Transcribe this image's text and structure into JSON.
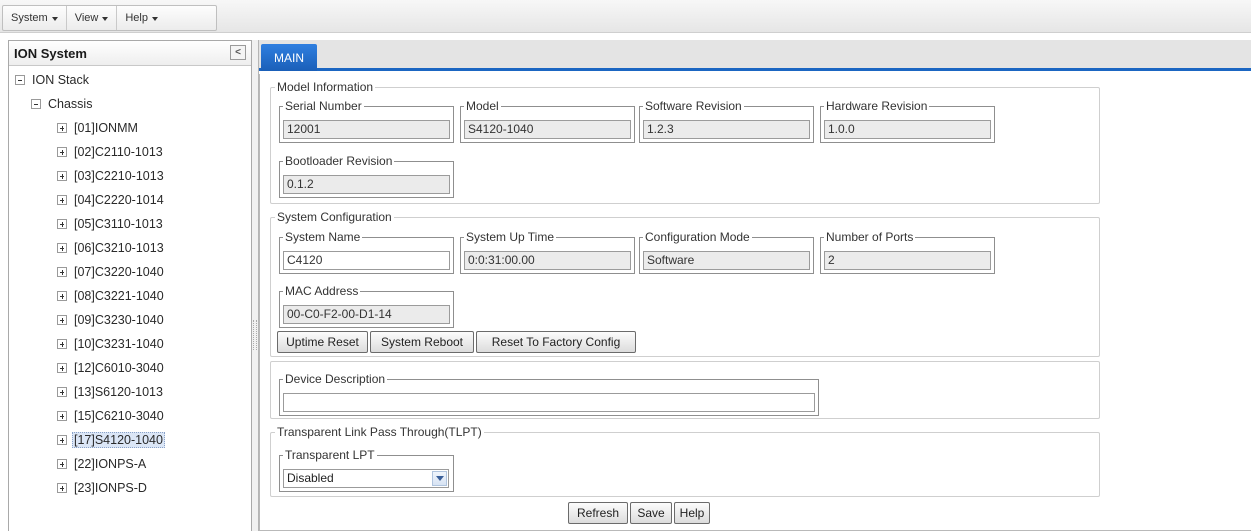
{
  "menubar": {
    "items": [
      {
        "label": "System"
      },
      {
        "label": "View"
      },
      {
        "label": "Help"
      }
    ]
  },
  "tree": {
    "title": "ION System",
    "collapse_glyph": "<",
    "root": "ION Stack",
    "chassis": "Chassis",
    "items": [
      "[01]IONMM",
      "[02]C2110-1013",
      "[03]C2210-1013",
      "[04]C2220-1014",
      "[05]C3110-1013",
      "[06]C3210-1013",
      "[07]C3220-1040",
      "[08]C3221-1040",
      "[09]C3230-1040",
      "[10]C3231-1040",
      "[12]C6010-3040",
      "[13]S6120-1013",
      "[15]C6210-3040",
      "[17]S4120-1040",
      "[22]IONPS-A",
      "[23]IONPS-D"
    ],
    "selected": "[17]S4120-1040"
  },
  "tabs": {
    "main_label": "MAIN"
  },
  "model_info": {
    "title": "Model Information",
    "serial_number_label": "Serial Number",
    "serial_number": "12001",
    "model_label": "Model",
    "model": "S4120-1040",
    "software_revision_label": "Software Revision",
    "software_revision": "1.2.3",
    "hardware_revision_label": "Hardware Revision",
    "hardware_revision": "1.0.0",
    "bootloader_revision_label": "Bootloader Revision",
    "bootloader_revision": "0.1.2"
  },
  "system_config": {
    "title": "System Configuration",
    "system_name_label": "System Name",
    "system_name": "C4120",
    "system_up_time_label": "System Up Time",
    "system_up_time": "0:0:31:00.00",
    "configuration_mode_label": "Configuration Mode",
    "configuration_mode": "Software",
    "number_of_ports_label": "Number of Ports",
    "number_of_ports": "2",
    "mac_address_label": "MAC Address",
    "mac_address": "00-C0-F2-00-D1-14",
    "uptime_reset_label": "Uptime Reset",
    "system_reboot_label": "System Reboot",
    "reset_factory_label": "Reset To Factory Config"
  },
  "device": {
    "description_label": "Device Description",
    "description": ""
  },
  "tlpt": {
    "title": "Transparent Link Pass Through(TLPT)",
    "transparent_lpt_label": "Transparent LPT",
    "transparent_lpt_value": "Disabled"
  },
  "footer": {
    "refresh_label": "Refresh",
    "save_label": "Save",
    "help_label": "Help"
  },
  "colors": {
    "tab_accent": "#1b66c2",
    "selection_bg": "#dbe6f6"
  }
}
